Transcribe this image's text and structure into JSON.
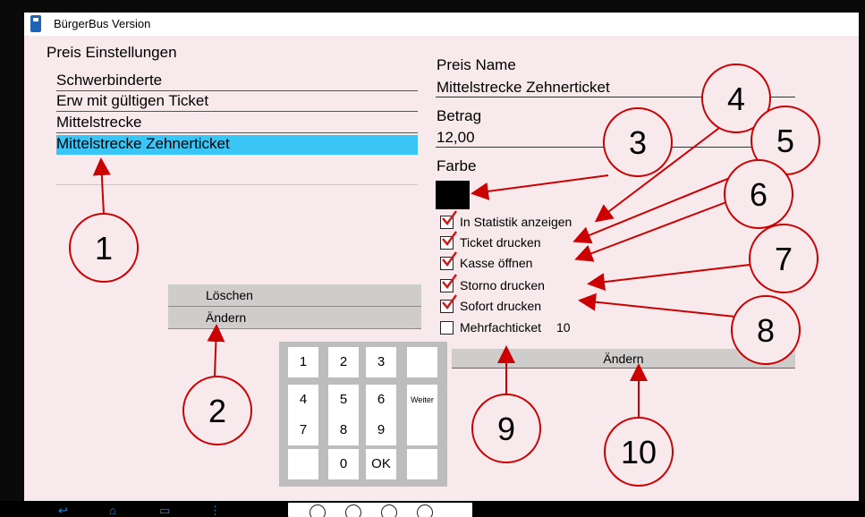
{
  "window": {
    "title": "BürgerBus Version"
  },
  "left": {
    "heading": "Preis Einstellungen",
    "items": [
      {
        "label": "Schwerbinderte"
      },
      {
        "label": "Erw mit gültigen Ticket"
      },
      {
        "label": "Mittelstrecke"
      },
      {
        "label": "Mittelstrecke Zehnerticket",
        "selected": true
      }
    ],
    "buttons": {
      "loeschen": "Löschen",
      "aendern": "Ändern"
    }
  },
  "right": {
    "name_label": "Preis Name",
    "name_value": "Mittelstrecke Zehnerticket",
    "betrag_label": "Betrag",
    "betrag_value": "12,00",
    "farbe_label": "Farbe",
    "farbe_color": "#000000",
    "checkboxes": [
      {
        "label": "In Statistik anzeigen",
        "checked": true
      },
      {
        "label": "Ticket drucken",
        "checked": true
      },
      {
        "label": "Kasse öffnen",
        "checked": true
      },
      {
        "label": "Storno drucken",
        "checked": true
      },
      {
        "label": "Sofort drucken",
        "checked": true
      },
      {
        "label": "Mehrfachticket",
        "checked": false,
        "value": "10"
      }
    ],
    "aendern_button": "Ändern"
  },
  "keypad": {
    "keys": [
      "1",
      "2",
      "3",
      "4",
      "5",
      "6",
      "7",
      "8",
      "9",
      "0",
      "OK"
    ],
    "weiter": "Weiter"
  },
  "callouts": [
    "1",
    "2",
    "3",
    "4",
    "5",
    "6",
    "7",
    "8",
    "9",
    "10"
  ],
  "colors": {
    "selection": "#39c5f6",
    "background": "#f7e9ec",
    "callout": "#cc0000"
  },
  "navbar": {
    "icons": [
      "back-icon",
      "home-icon",
      "recent-apps-icon",
      "menu-icon"
    ]
  }
}
